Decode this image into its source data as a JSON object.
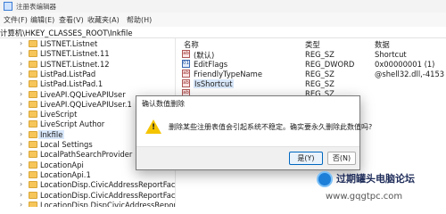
{
  "window": {
    "title": "注册表编辑器",
    "icon": "registry-editor-icon"
  },
  "menu": [
    "文件(F)",
    "编辑(E)",
    "查看(V)",
    "收藏夹(A)",
    "帮助(H)"
  ],
  "address": "计算机\\HKEY_CLASSES_ROOT\\Inkfile",
  "tree": [
    {
      "label": "LISTNET.Listnet",
      "selected": false
    },
    {
      "label": "LISTNET.Listnet.11",
      "selected": false
    },
    {
      "label": "LISTNET.Listnet.12",
      "selected": false
    },
    {
      "label": "ListPad.ListPad",
      "selected": false
    },
    {
      "label": "ListPad.ListPad.1",
      "selected": false
    },
    {
      "label": "LiveAPI.QQLiveAPIUser",
      "selected": false
    },
    {
      "label": "LiveAPI.QQLiveAPIUser.1",
      "selected": false
    },
    {
      "label": "LiveScript",
      "selected": false
    },
    {
      "label": "LiveScript Author",
      "selected": false
    },
    {
      "label": "Inkfile",
      "selected": true
    },
    {
      "label": "Local Settings",
      "selected": false
    },
    {
      "label": "LocalPathSearchProvider",
      "selected": false
    },
    {
      "label": "LocationApi",
      "selected": false
    },
    {
      "label": "LocationApi.1",
      "selected": false
    },
    {
      "label": "LocationDisp.CivicAddressReportFactor",
      "selected": false
    },
    {
      "label": "LocationDisp.CivicAddressReportFactor",
      "selected": false
    },
    {
      "label": "LocationDisp.DispCivicAddressReport",
      "selected": false
    }
  ],
  "values_header": {
    "name": "名称",
    "type": "类型",
    "data": "数据"
  },
  "values": [
    {
      "name": "(默认)",
      "type": "REG_SZ",
      "data": "Shortcut",
      "icon": "string-value-icon",
      "selected": false
    },
    {
      "name": "EditFlags",
      "type": "REG_DWORD",
      "data": "0x00000001 (1)",
      "icon": "binary-value-icon",
      "selected": false
    },
    {
      "name": "FriendlyTypeName",
      "type": "REG_SZ",
      "data": "@shell32.dll,-4153",
      "icon": "string-value-icon",
      "selected": false
    },
    {
      "name": "IsShortcut",
      "type": "REG_SZ",
      "data": "",
      "icon": "string-value-icon",
      "selected": true
    },
    {
      "name": "",
      "type": "REG_SZ",
      "data": "",
      "icon": "string-value-icon",
      "selected": false
    }
  ],
  "dialog": {
    "title": "确认数值删除",
    "message": "删除某些注册表值会引起系统不稳定。确实要永久删除此数值吗?",
    "icon": "warning-icon",
    "yes_label": "是(Y)",
    "no_label": "否(N)"
  },
  "watermark": {
    "text": "过期罐头电脑论坛",
    "url": "www.gqgtpc.com"
  }
}
